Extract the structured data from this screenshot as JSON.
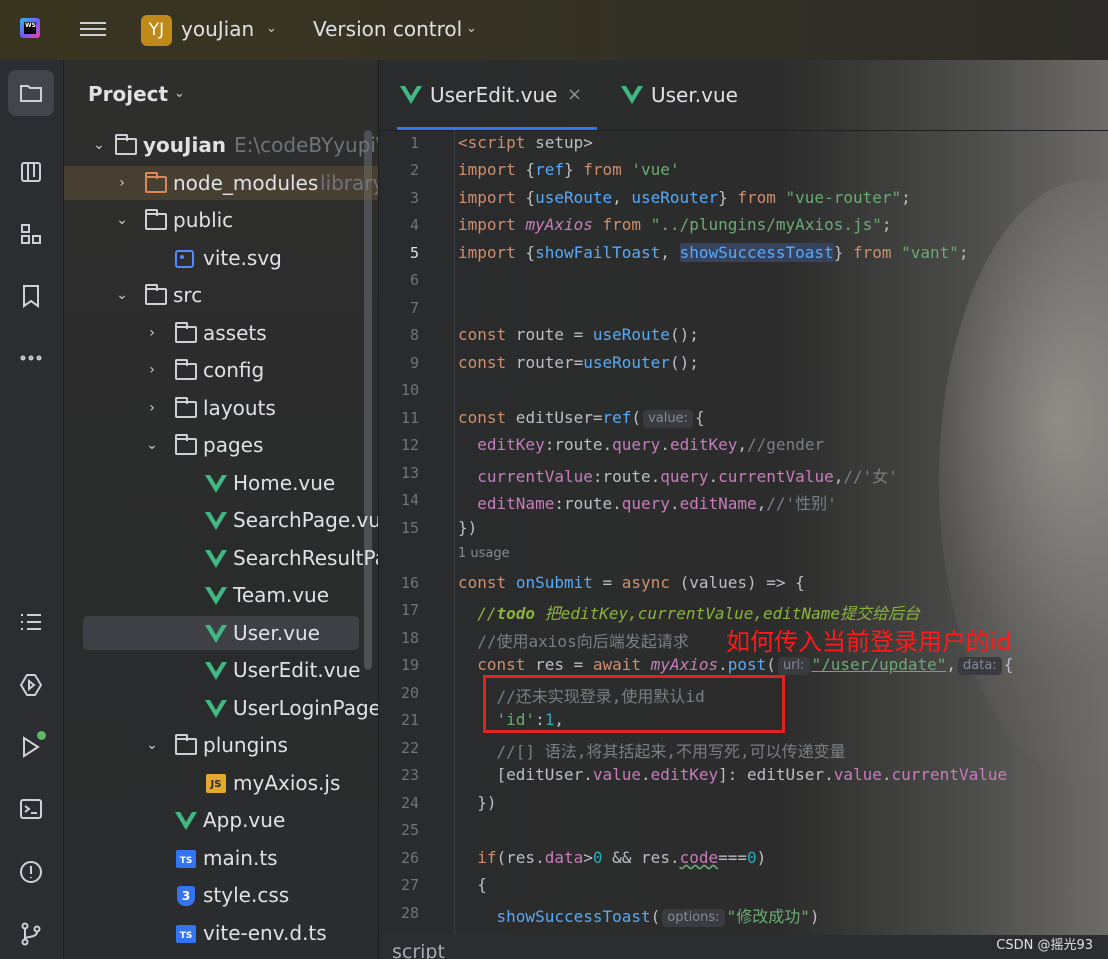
{
  "topbar": {
    "app_icon": "webstorm-icon",
    "project_badge": "YJ",
    "project_name": "youJian",
    "vcs_label": "Version control"
  },
  "toolstrip": {
    "icons": [
      "folder-icon",
      "structure-icon",
      "plugins-icon",
      "bookmark-icon",
      "more-icon",
      "todo-icon",
      "services-icon",
      "run-icon",
      "terminal-icon",
      "problems-icon",
      "git-icon"
    ]
  },
  "project_panel": {
    "title": "Project",
    "tree": [
      {
        "label": "youJian",
        "hint": "E:\\codeBYyupi\\",
        "type": "folder"
      },
      {
        "label": "node_modules",
        "hint": "library",
        "type": "folder-orange"
      },
      {
        "label": "public",
        "type": "folder"
      },
      {
        "label": "vite.svg",
        "type": "svg"
      },
      {
        "label": "src",
        "type": "folder"
      },
      {
        "label": "assets",
        "type": "folder"
      },
      {
        "label": "config",
        "type": "folder"
      },
      {
        "label": "layouts",
        "type": "folder"
      },
      {
        "label": "pages",
        "type": "folder"
      },
      {
        "label": "Home.vue",
        "type": "vue"
      },
      {
        "label": "SearchPage.vu",
        "type": "vue"
      },
      {
        "label": "SearchResultPa",
        "type": "vue"
      },
      {
        "label": "Team.vue",
        "type": "vue"
      },
      {
        "label": "User.vue",
        "type": "vue"
      },
      {
        "label": "UserEdit.vue",
        "type": "vue"
      },
      {
        "label": "UserLoginPage",
        "type": "vue"
      },
      {
        "label": "plungins",
        "type": "folder"
      },
      {
        "label": "myAxios.js",
        "type": "js"
      },
      {
        "label": "App.vue",
        "type": "vue"
      },
      {
        "label": "main.ts",
        "type": "ts"
      },
      {
        "label": "style.css",
        "type": "css"
      },
      {
        "label": "vite-env.d.ts",
        "type": "ts"
      }
    ]
  },
  "editor": {
    "tabs": [
      {
        "label": "UserEdit.vue",
        "active": true
      },
      {
        "label": "User.vue",
        "active": false
      }
    ],
    "close_glyph": "×",
    "line_numbers": [
      "1",
      "2",
      "3",
      "4",
      "5",
      "6",
      "7",
      "8",
      "9",
      "10",
      "11",
      "12",
      "13",
      "14",
      "15",
      "16",
      "17",
      "18",
      "19",
      "20",
      "21",
      "22",
      "23",
      "24",
      "25",
      "26",
      "27",
      "28"
    ],
    "usage_hint": "1 usage",
    "inlay_hints": {
      "value": "value:",
      "url": "url:",
      "data": "data:",
      "options": "options:"
    },
    "annotation": "如何传入当前登录用户的id",
    "status_text": "script",
    "watermark": "CSDN @摇光93",
    "code": {
      "l1_tag": "<script",
      "l1_rest": " setup>",
      "l2": [
        "import",
        " {",
        "ref",
        "} ",
        "from",
        " ",
        "'vue'"
      ],
      "l3": [
        "import",
        " {",
        "useRoute",
        ", ",
        "useRouter",
        "} ",
        "from",
        " ",
        "\"vue-router\"",
        ";"
      ],
      "l4": [
        "import",
        " ",
        "myAxios",
        " ",
        "from",
        " ",
        "\"../plungins/myAxios.js\"",
        ";"
      ],
      "l5": [
        "import",
        " {",
        "showFailToast",
        ", ",
        "showSuccessToast",
        "} ",
        "from",
        " ",
        "\"vant\"",
        ";"
      ],
      "l8": [
        "const",
        " route = ",
        "useRoute",
        "();"
      ],
      "l9": [
        "const",
        " router=",
        "useRouter",
        "();"
      ],
      "l11": [
        "const",
        " editUser=",
        "ref",
        "(",
        "{"
      ],
      "l12": [
        "editKey",
        ":route.",
        "query",
        ".",
        "editKey",
        ",",
        "//gender"
      ],
      "l13": [
        "currentValue",
        ":route.",
        "query",
        ".",
        "currentValue",
        ",",
        "//'女'"
      ],
      "l14": [
        "editName",
        ":route.",
        "query",
        ".",
        "editName",
        ",",
        "//'性别'"
      ],
      "l15": "})",
      "l16": [
        "const",
        " ",
        "onSubmit",
        " = ",
        "async",
        " (values) => {"
      ],
      "l17": [
        "//",
        "todo",
        " 把editKey,currentValue,editName提交给后台"
      ],
      "l18": "//使用axios向后端发起请求",
      "l19": [
        "const",
        " res = ",
        "await",
        " ",
        "myAxios",
        ".",
        "post",
        "(",
        "\"/user/update\"",
        ",",
        "{"
      ],
      "l20": "//还未实现登录,使用默认id",
      "l21": [
        "'id'",
        ":",
        "1",
        ","
      ],
      "l22": "//[] 语法,将其括起来,不用写死,可以传递变量",
      "l23": [
        "[editUser.",
        "value",
        ".",
        "editKey",
        "]: editUser.",
        "value",
        ".",
        "currentValue"
      ],
      "l24": "})",
      "l26": [
        "if",
        "(res.",
        "data",
        ">",
        "0",
        " && res.",
        "code",
        "===",
        "0",
        ")"
      ],
      "l27": "{",
      "l28": [
        "showSuccessToast",
        "(",
        "\"修改成功\"",
        ")"
      ]
    }
  }
}
